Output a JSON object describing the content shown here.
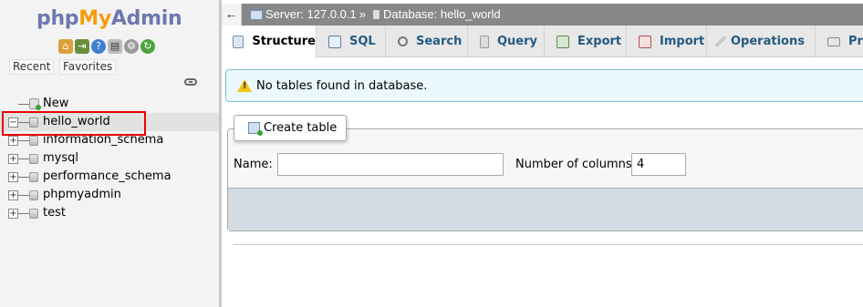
{
  "nav": {
    "logo": {
      "php": "php",
      "my": "My",
      "admin": "Admin"
    },
    "quick_icons": [
      "home-icon",
      "exit-icon",
      "help-icon",
      "docs-icon",
      "settings-icon",
      "reload-icon"
    ],
    "recent_label": "Recent",
    "favorites_label": "Favorites",
    "tree": [
      {
        "label": "New",
        "type": "new"
      },
      {
        "label": "hello_world",
        "type": "db",
        "expanded": true,
        "selected": true
      },
      {
        "label": "information_schema",
        "type": "db"
      },
      {
        "label": "mysql",
        "type": "db"
      },
      {
        "label": "performance_schema",
        "type": "db"
      },
      {
        "label": "phpmyadmin",
        "type": "db"
      },
      {
        "label": "test",
        "type": "db"
      }
    ]
  },
  "topbar": {
    "back": "←",
    "server": "Server: 127.0.0.1",
    "separator": "»",
    "database": "Database: hello_world"
  },
  "tabs": [
    {
      "label": "Structure",
      "icon": "structure-icon",
      "active": true
    },
    {
      "label": "SQL",
      "icon": "sql-icon"
    },
    {
      "label": "Search",
      "icon": "search-icon"
    },
    {
      "label": "Query",
      "icon": "query-icon"
    },
    {
      "label": "Export",
      "icon": "export-icon"
    },
    {
      "label": "Import",
      "icon": "import-icon"
    },
    {
      "label": "Operations",
      "icon": "wrench-icon"
    },
    {
      "label": "Pr",
      "icon": "privileges-icon"
    }
  ],
  "notice": {
    "text": "No tables found in database."
  },
  "create_table": {
    "legend": "Create table",
    "name_label": "Name:",
    "name_value": "",
    "columns_label": "Number of columns:",
    "columns_value": "4"
  },
  "colors": {
    "nav_bg": "#f3f3f3",
    "topbar_bg": "#888888",
    "tab_text": "#235a81",
    "notice_bg": "#ebf8fd",
    "notice_border": "#7ec0dd",
    "highlight": "#ee0000"
  }
}
